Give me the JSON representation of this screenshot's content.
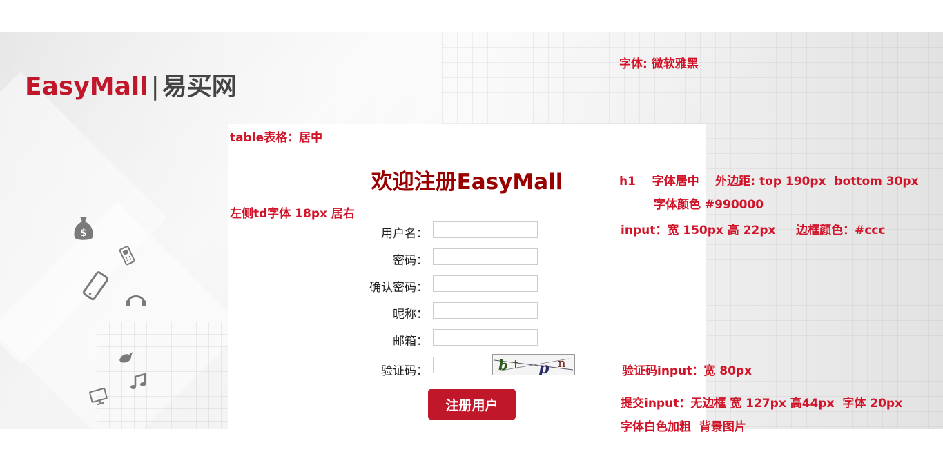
{
  "logo": {
    "brand": "EasyMall",
    "separator": "|",
    "cn": "易买网"
  },
  "annotations": {
    "font": "字体: 微软雅黑",
    "table": "table表格：居中",
    "h1_line1": "h1    字体居中    外边距: top 190px  bottom 30px",
    "h1_line2": "字体颜色 #990000",
    "left_td": "左侧td字体 18px 居右",
    "input": "input：宽 150px 高 22px     边框颜色：#ccc",
    "captcha_input": "验证码input：宽 80px",
    "submit_line1": "提交input：无边框 宽 127px 高44px  字体 20px",
    "submit_line2": "字体白色加粗  背景图片"
  },
  "form": {
    "title": "欢迎注册EasyMall",
    "fields": [
      {
        "label": "用户名：",
        "value": ""
      },
      {
        "label": "密码：",
        "value": ""
      },
      {
        "label": "确认密码：",
        "value": ""
      },
      {
        "label": "昵称：",
        "value": ""
      },
      {
        "label": "邮箱：",
        "value": ""
      },
      {
        "label": "验证码：",
        "value": ""
      }
    ],
    "captcha_text": "btpn",
    "submit_label": "注册用户"
  },
  "colors": {
    "brand": "#c0172b",
    "title": "#990000",
    "note": "#d0152a",
    "input_border": "#cccccc"
  },
  "icons": [
    "money-bag-icon",
    "phone-icon",
    "smartphone-icon",
    "headphones-icon",
    "bird-icon",
    "music-note-icon",
    "monitor-icon"
  ]
}
